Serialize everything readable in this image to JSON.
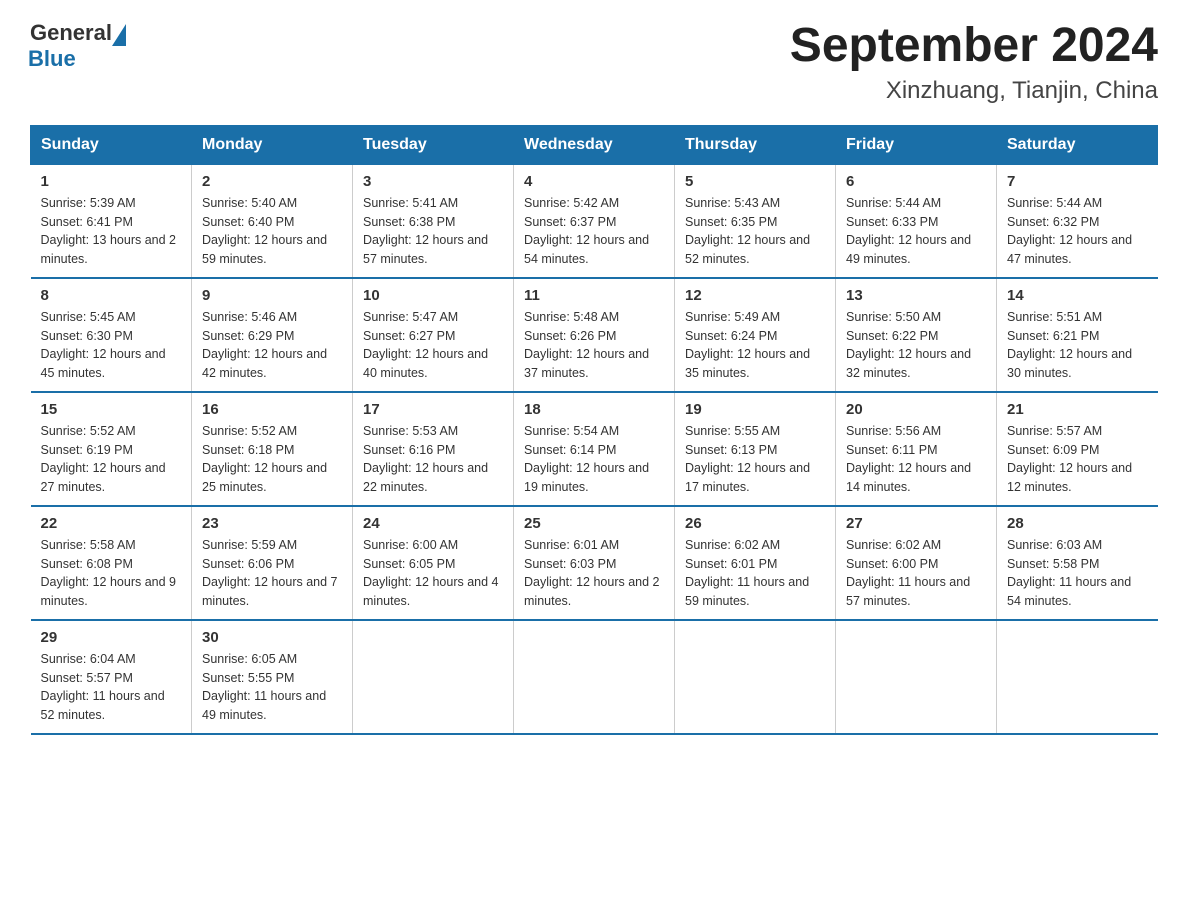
{
  "logo": {
    "general": "General",
    "blue": "Blue"
  },
  "title": "September 2024",
  "subtitle": "Xinzhuang, Tianjin, China",
  "days_of_week": [
    "Sunday",
    "Monday",
    "Tuesday",
    "Wednesday",
    "Thursday",
    "Friday",
    "Saturday"
  ],
  "weeks": [
    [
      {
        "day": "1",
        "sunrise": "5:39 AM",
        "sunset": "6:41 PM",
        "daylight": "13 hours and 2 minutes."
      },
      {
        "day": "2",
        "sunrise": "5:40 AM",
        "sunset": "6:40 PM",
        "daylight": "12 hours and 59 minutes."
      },
      {
        "day": "3",
        "sunrise": "5:41 AM",
        "sunset": "6:38 PM",
        "daylight": "12 hours and 57 minutes."
      },
      {
        "day": "4",
        "sunrise": "5:42 AM",
        "sunset": "6:37 PM",
        "daylight": "12 hours and 54 minutes."
      },
      {
        "day": "5",
        "sunrise": "5:43 AM",
        "sunset": "6:35 PM",
        "daylight": "12 hours and 52 minutes."
      },
      {
        "day": "6",
        "sunrise": "5:44 AM",
        "sunset": "6:33 PM",
        "daylight": "12 hours and 49 minutes."
      },
      {
        "day": "7",
        "sunrise": "5:44 AM",
        "sunset": "6:32 PM",
        "daylight": "12 hours and 47 minutes."
      }
    ],
    [
      {
        "day": "8",
        "sunrise": "5:45 AM",
        "sunset": "6:30 PM",
        "daylight": "12 hours and 45 minutes."
      },
      {
        "day": "9",
        "sunrise": "5:46 AM",
        "sunset": "6:29 PM",
        "daylight": "12 hours and 42 minutes."
      },
      {
        "day": "10",
        "sunrise": "5:47 AM",
        "sunset": "6:27 PM",
        "daylight": "12 hours and 40 minutes."
      },
      {
        "day": "11",
        "sunrise": "5:48 AM",
        "sunset": "6:26 PM",
        "daylight": "12 hours and 37 minutes."
      },
      {
        "day": "12",
        "sunrise": "5:49 AM",
        "sunset": "6:24 PM",
        "daylight": "12 hours and 35 minutes."
      },
      {
        "day": "13",
        "sunrise": "5:50 AM",
        "sunset": "6:22 PM",
        "daylight": "12 hours and 32 minutes."
      },
      {
        "day": "14",
        "sunrise": "5:51 AM",
        "sunset": "6:21 PM",
        "daylight": "12 hours and 30 minutes."
      }
    ],
    [
      {
        "day": "15",
        "sunrise": "5:52 AM",
        "sunset": "6:19 PM",
        "daylight": "12 hours and 27 minutes."
      },
      {
        "day": "16",
        "sunrise": "5:52 AM",
        "sunset": "6:18 PM",
        "daylight": "12 hours and 25 minutes."
      },
      {
        "day": "17",
        "sunrise": "5:53 AM",
        "sunset": "6:16 PM",
        "daylight": "12 hours and 22 minutes."
      },
      {
        "day": "18",
        "sunrise": "5:54 AM",
        "sunset": "6:14 PM",
        "daylight": "12 hours and 19 minutes."
      },
      {
        "day": "19",
        "sunrise": "5:55 AM",
        "sunset": "6:13 PM",
        "daylight": "12 hours and 17 minutes."
      },
      {
        "day": "20",
        "sunrise": "5:56 AM",
        "sunset": "6:11 PM",
        "daylight": "12 hours and 14 minutes."
      },
      {
        "day": "21",
        "sunrise": "5:57 AM",
        "sunset": "6:09 PM",
        "daylight": "12 hours and 12 minutes."
      }
    ],
    [
      {
        "day": "22",
        "sunrise": "5:58 AM",
        "sunset": "6:08 PM",
        "daylight": "12 hours and 9 minutes."
      },
      {
        "day": "23",
        "sunrise": "5:59 AM",
        "sunset": "6:06 PM",
        "daylight": "12 hours and 7 minutes."
      },
      {
        "day": "24",
        "sunrise": "6:00 AM",
        "sunset": "6:05 PM",
        "daylight": "12 hours and 4 minutes."
      },
      {
        "day": "25",
        "sunrise": "6:01 AM",
        "sunset": "6:03 PM",
        "daylight": "12 hours and 2 minutes."
      },
      {
        "day": "26",
        "sunrise": "6:02 AM",
        "sunset": "6:01 PM",
        "daylight": "11 hours and 59 minutes."
      },
      {
        "day": "27",
        "sunrise": "6:02 AM",
        "sunset": "6:00 PM",
        "daylight": "11 hours and 57 minutes."
      },
      {
        "day": "28",
        "sunrise": "6:03 AM",
        "sunset": "5:58 PM",
        "daylight": "11 hours and 54 minutes."
      }
    ],
    [
      {
        "day": "29",
        "sunrise": "6:04 AM",
        "sunset": "5:57 PM",
        "daylight": "11 hours and 52 minutes."
      },
      {
        "day": "30",
        "sunrise": "6:05 AM",
        "sunset": "5:55 PM",
        "daylight": "11 hours and 49 minutes."
      },
      null,
      null,
      null,
      null,
      null
    ]
  ]
}
